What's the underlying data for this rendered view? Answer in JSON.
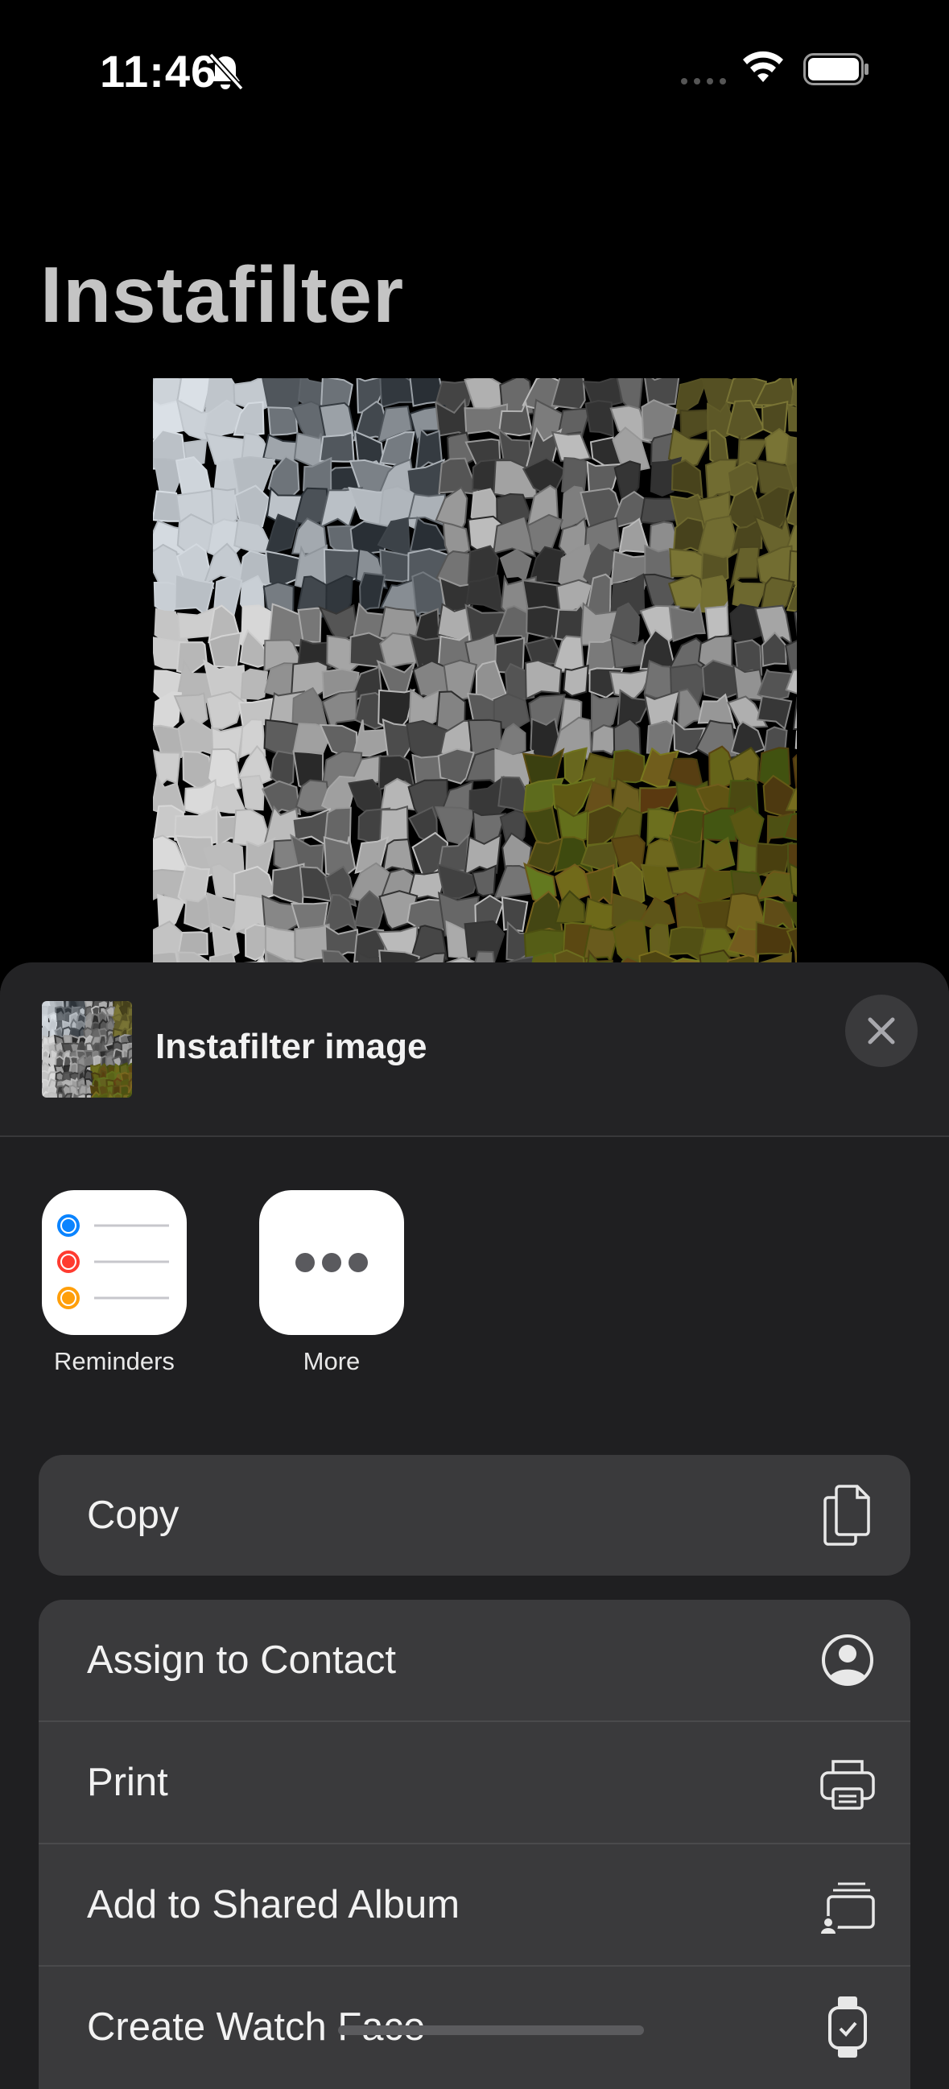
{
  "status": {
    "time": "11:46"
  },
  "app": {
    "title": "Instafilter"
  },
  "share_sheet": {
    "title": "Instafilter image",
    "apps": [
      {
        "label": "Reminders",
        "icon": "reminders-icon"
      },
      {
        "label": "More",
        "icon": "more-icon"
      }
    ],
    "actions_primary": [
      {
        "label": "Copy",
        "icon": "copy-icon"
      }
    ],
    "actions_secondary": [
      {
        "label": "Assign to Contact",
        "icon": "person-circle-icon"
      },
      {
        "label": "Print",
        "icon": "printer-icon"
      },
      {
        "label": "Add to Shared Album",
        "icon": "shared-album-icon"
      },
      {
        "label": "Create Watch Face",
        "icon": "watch-icon"
      }
    ]
  },
  "colors": {
    "sheet_bg": "#1f1f21",
    "row_bg": "#3a3a3c",
    "title_gray": "#c4c4c4"
  }
}
